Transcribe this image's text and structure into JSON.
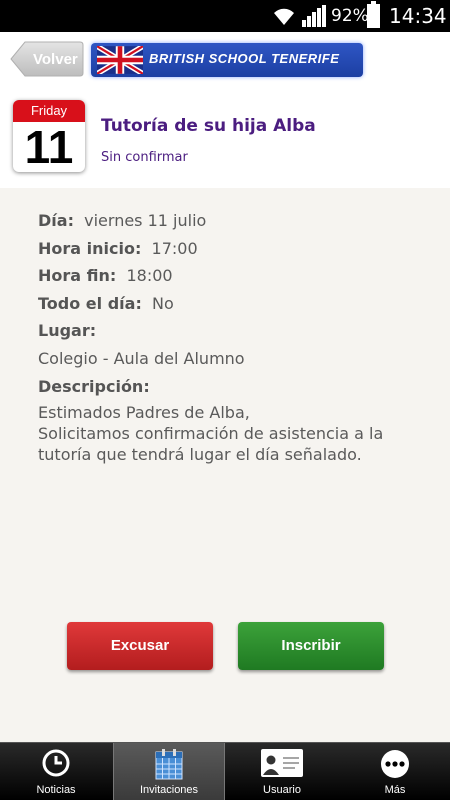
{
  "status_bar": {
    "battery_percent": "92%",
    "time": "14:34"
  },
  "header": {
    "back_label": "Volver",
    "school_name": "BRITISH SCHOOL TENERIFE"
  },
  "event": {
    "calendar_day": "Friday",
    "calendar_number": "11",
    "title": "Tutoría de su hija Alba",
    "status": "Sin confirmar"
  },
  "details": {
    "dia_label": "Día:",
    "dia_value": "viernes 11 julio",
    "hora_inicio_label": "Hora inicio:",
    "hora_inicio_value": "17:00",
    "hora_fin_label": "Hora fin:",
    "hora_fin_value": "18:00",
    "todo_dia_label": "Todo el día:",
    "todo_dia_value": "No",
    "lugar_label": "Lugar:",
    "lugar_value": "Colegio - Aula del Alumno",
    "descripcion_label": "Descripción:",
    "descripcion_value": "Estimados Padres de Alba,\nSolicitamos confirmación de asistencia a la tutoría que tendrá lugar el día señalado."
  },
  "actions": {
    "excusar_label": "Excusar",
    "inscribir_label": "Inscribir",
    "excusar_color": "#c62828",
    "inscribir_color": "#2e8b2e"
  },
  "tabs": [
    {
      "label": "Noticias",
      "icon": "clock-icon"
    },
    {
      "label": "Invitaciones",
      "icon": "calendar-icon",
      "active": true
    },
    {
      "label": "Usuario",
      "icon": "id-card-icon"
    },
    {
      "label": "Más",
      "icon": "more-icon"
    }
  ]
}
